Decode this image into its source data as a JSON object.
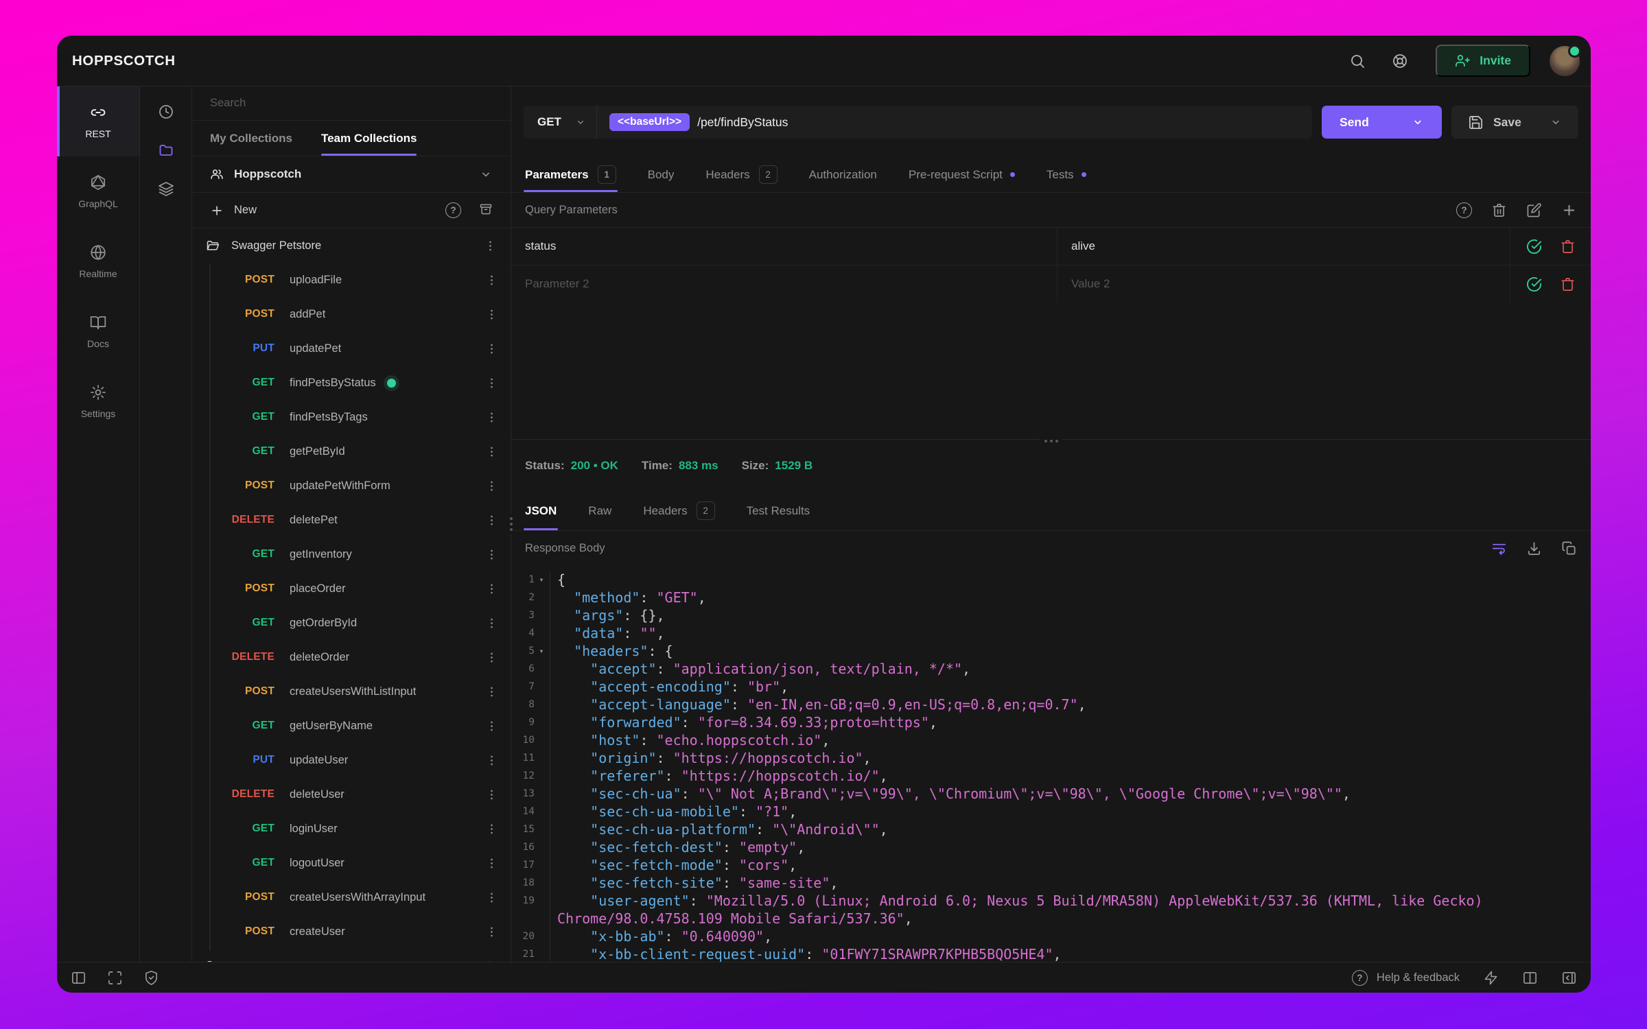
{
  "app": {
    "title": "HOPPSCOTCH"
  },
  "topbar": {
    "invite_label": "Invite"
  },
  "nav": {
    "items": [
      {
        "label": "REST",
        "active": true
      },
      {
        "label": "GraphQL"
      },
      {
        "label": "Realtime"
      },
      {
        "label": "Docs"
      },
      {
        "label": "Settings"
      }
    ]
  },
  "collections": {
    "search_placeholder": "Search",
    "tabs": [
      {
        "label": "My Collections"
      },
      {
        "label": "Team Collections",
        "active": true
      }
    ],
    "team_name": "Hoppscotch",
    "new_label": "New",
    "folder_label": "Swagger Petstore",
    "clipped_folder_label": "",
    "requests": [
      {
        "method": "POST",
        "name": "uploadFile"
      },
      {
        "method": "POST",
        "name": "addPet"
      },
      {
        "method": "PUT",
        "name": "updatePet"
      },
      {
        "method": "GET",
        "name": "findPetsByStatus",
        "active": true
      },
      {
        "method": "GET",
        "name": "findPetsByTags"
      },
      {
        "method": "GET",
        "name": "getPetById"
      },
      {
        "method": "POST",
        "name": "updatePetWithForm"
      },
      {
        "method": "DELETE",
        "name": "deletePet"
      },
      {
        "method": "GET",
        "name": "getInventory"
      },
      {
        "method": "POST",
        "name": "placeOrder"
      },
      {
        "method": "GET",
        "name": "getOrderById"
      },
      {
        "method": "DELETE",
        "name": "deleteOrder"
      },
      {
        "method": "POST",
        "name": "createUsersWithListInput"
      },
      {
        "method": "GET",
        "name": "getUserByName"
      },
      {
        "method": "PUT",
        "name": "updateUser"
      },
      {
        "method": "DELETE",
        "name": "deleteUser"
      },
      {
        "method": "GET",
        "name": "loginUser"
      },
      {
        "method": "GET",
        "name": "logoutUser"
      },
      {
        "method": "POST",
        "name": "createUsersWithArrayInput"
      },
      {
        "method": "POST",
        "name": "createUser"
      }
    ]
  },
  "request": {
    "method": "GET",
    "url_env": "<<baseUrl>>",
    "url_path": "/pet/findByStatus",
    "send_label": "Send",
    "save_label": "Save",
    "tabs": [
      {
        "label": "Parameters",
        "badge": "1",
        "active": true
      },
      {
        "label": "Body"
      },
      {
        "label": "Headers",
        "badge": "2"
      },
      {
        "label": "Authorization"
      },
      {
        "label": "Pre-request Script",
        "dot": true
      },
      {
        "label": "Tests",
        "dot": true
      }
    ],
    "section_title": "Query Parameters",
    "params": [
      {
        "key": "status",
        "value": "alive",
        "placeholder": false
      },
      {
        "key": "Parameter 2",
        "value": "Value 2",
        "placeholder": true
      }
    ]
  },
  "response": {
    "status_label": "Status:",
    "status_value": "200 • OK",
    "time_label": "Time:",
    "time_value": "883 ms",
    "size_label": "Size:",
    "size_value": "1529 B",
    "tabs": [
      {
        "label": "JSON",
        "active": true
      },
      {
        "label": "Raw"
      },
      {
        "label": "Headers",
        "badge": "2"
      },
      {
        "label": "Test Results"
      }
    ],
    "body_label": "Response Body",
    "code": [
      {
        "n": "1",
        "fold": true,
        "segs": [
          [
            "p",
            "{"
          ]
        ]
      },
      {
        "n": "2",
        "segs": [
          [
            "w",
            "  "
          ],
          [
            "k",
            "\"method\""
          ],
          [
            "p",
            ": "
          ],
          [
            "s",
            "\"GET\""
          ],
          [
            "p",
            ","
          ]
        ]
      },
      {
        "n": "3",
        "segs": [
          [
            "w",
            "  "
          ],
          [
            "k",
            "\"args\""
          ],
          [
            "p",
            ": {},"
          ]
        ]
      },
      {
        "n": "4",
        "segs": [
          [
            "w",
            "  "
          ],
          [
            "k",
            "\"data\""
          ],
          [
            "p",
            ": "
          ],
          [
            "s",
            "\"\""
          ],
          [
            "p",
            ","
          ]
        ]
      },
      {
        "n": "5",
        "fold": true,
        "segs": [
          [
            "w",
            "  "
          ],
          [
            "k",
            "\"headers\""
          ],
          [
            "p",
            ": {"
          ]
        ]
      },
      {
        "n": "6",
        "segs": [
          [
            "w",
            "    "
          ],
          [
            "k",
            "\"accept\""
          ],
          [
            "p",
            ": "
          ],
          [
            "s",
            "\"application/json, text/plain, */*\""
          ],
          [
            "p",
            ","
          ]
        ]
      },
      {
        "n": "7",
        "segs": [
          [
            "w",
            "    "
          ],
          [
            "k",
            "\"accept-encoding\""
          ],
          [
            "p",
            ": "
          ],
          [
            "s",
            "\"br\""
          ],
          [
            "p",
            ","
          ]
        ]
      },
      {
        "n": "8",
        "segs": [
          [
            "w",
            "    "
          ],
          [
            "k",
            "\"accept-language\""
          ],
          [
            "p",
            ": "
          ],
          [
            "s",
            "\"en-IN,en-GB;q=0.9,en-US;q=0.8,en;q=0.7\""
          ],
          [
            "p",
            ","
          ]
        ]
      },
      {
        "n": "9",
        "segs": [
          [
            "w",
            "    "
          ],
          [
            "k",
            "\"forwarded\""
          ],
          [
            "p",
            ": "
          ],
          [
            "s",
            "\"for=8.34.69.33;proto=https\""
          ],
          [
            "p",
            ","
          ]
        ]
      },
      {
        "n": "10",
        "segs": [
          [
            "w",
            "    "
          ],
          [
            "k",
            "\"host\""
          ],
          [
            "p",
            ": "
          ],
          [
            "s",
            "\"echo.hoppscotch.io\""
          ],
          [
            "p",
            ","
          ]
        ]
      },
      {
        "n": "11",
        "segs": [
          [
            "w",
            "    "
          ],
          [
            "k",
            "\"origin\""
          ],
          [
            "p",
            ": "
          ],
          [
            "s",
            "\"https://hoppscotch.io\""
          ],
          [
            "p",
            ","
          ]
        ]
      },
      {
        "n": "12",
        "segs": [
          [
            "w",
            "    "
          ],
          [
            "k",
            "\"referer\""
          ],
          [
            "p",
            ": "
          ],
          [
            "s",
            "\"https://hoppscotch.io/\""
          ],
          [
            "p",
            ","
          ]
        ]
      },
      {
        "n": "13",
        "segs": [
          [
            "w",
            "    "
          ],
          [
            "k",
            "\"sec-ch-ua\""
          ],
          [
            "p",
            ": "
          ],
          [
            "s",
            "\"\\\" Not A;Brand\\\";v=\\\"99\\\", \\\"Chromium\\\";v=\\\"98\\\", \\\"Google Chrome\\\";v=\\\"98\\\"\""
          ],
          [
            "p",
            ","
          ]
        ]
      },
      {
        "n": "14",
        "segs": [
          [
            "w",
            "    "
          ],
          [
            "k",
            "\"sec-ch-ua-mobile\""
          ],
          [
            "p",
            ": "
          ],
          [
            "s",
            "\"?1\""
          ],
          [
            "p",
            ","
          ]
        ]
      },
      {
        "n": "15",
        "segs": [
          [
            "w",
            "    "
          ],
          [
            "k",
            "\"sec-ch-ua-platform\""
          ],
          [
            "p",
            ": "
          ],
          [
            "s",
            "\"\\\"Android\\\"\""
          ],
          [
            "p",
            ","
          ]
        ]
      },
      {
        "n": "16",
        "segs": [
          [
            "w",
            "    "
          ],
          [
            "k",
            "\"sec-fetch-dest\""
          ],
          [
            "p",
            ": "
          ],
          [
            "s",
            "\"empty\""
          ],
          [
            "p",
            ","
          ]
        ]
      },
      {
        "n": "17",
        "segs": [
          [
            "w",
            "    "
          ],
          [
            "k",
            "\"sec-fetch-mode\""
          ],
          [
            "p",
            ": "
          ],
          [
            "s",
            "\"cors\""
          ],
          [
            "p",
            ","
          ]
        ]
      },
      {
        "n": "18",
        "segs": [
          [
            "w",
            "    "
          ],
          [
            "k",
            "\"sec-fetch-site\""
          ],
          [
            "p",
            ": "
          ],
          [
            "s",
            "\"same-site\""
          ],
          [
            "p",
            ","
          ]
        ]
      },
      {
        "n": "19",
        "segs": [
          [
            "w",
            "    "
          ],
          [
            "k",
            "\"user-agent\""
          ],
          [
            "p",
            ": "
          ],
          [
            "s",
            "\"Mozilla/5.0 (Linux; Android 6.0; Nexus 5 Build/MRA58N) AppleWebKit/537.36 (KHTML, like Gecko) Chrome/98.0.4758.109 Mobile Safari/537.36\""
          ],
          [
            "p",
            ","
          ]
        ]
      },
      {
        "n": "20",
        "segs": [
          [
            "w",
            "    "
          ],
          [
            "k",
            "\"x-bb-ab\""
          ],
          [
            "p",
            ": "
          ],
          [
            "s",
            "\"0.640090\""
          ],
          [
            "p",
            ","
          ]
        ]
      },
      {
        "n": "21",
        "segs": [
          [
            "w",
            "    "
          ],
          [
            "k",
            "\"x-bb-client-request-uuid\""
          ],
          [
            "p",
            ": "
          ],
          [
            "s",
            "\"01FWY71SRAWPR7KPHB5BQO5HE4\""
          ],
          [
            "p",
            ","
          ]
        ]
      }
    ]
  },
  "statusbar": {
    "help_label": "Help & feedback"
  },
  "colors": {
    "accent": "#8566f6",
    "send": "#7b5cf6",
    "green": "#1fb786",
    "active_dot": "#34d399",
    "get": "#1ec27b",
    "post": "#e8a33d",
    "put": "#4678f2",
    "delete": "#e25549",
    "code_key": "#61aee6",
    "code_string": "#d66fd1"
  }
}
